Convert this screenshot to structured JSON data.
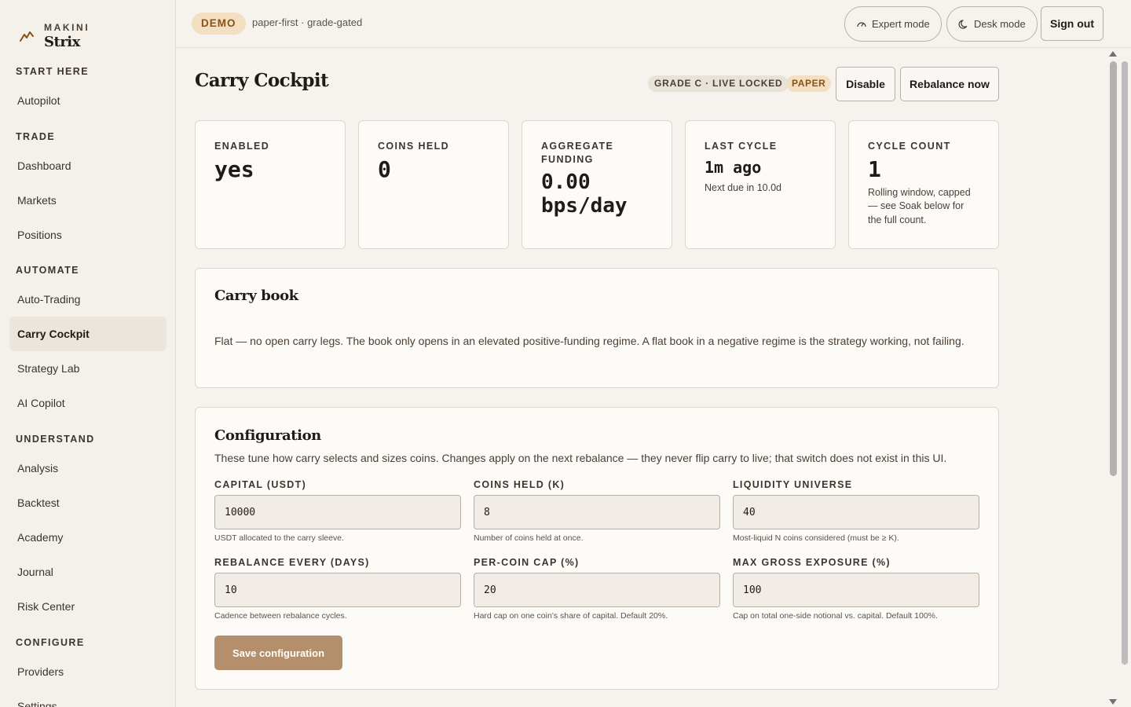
{
  "brand": {
    "kicker": "MAKINI",
    "name": "Strix"
  },
  "nav": {
    "sections": [
      {
        "title": "START HERE",
        "items": [
          "Autopilot"
        ]
      },
      {
        "title": "TRADE",
        "items": [
          "Dashboard",
          "Markets",
          "Positions"
        ]
      },
      {
        "title": "AUTOMATE",
        "items": [
          "Auto-Trading",
          "Carry Cockpit",
          "Strategy Lab",
          "AI Copilot"
        ]
      },
      {
        "title": "UNDERSTAND",
        "items": [
          "Analysis",
          "Backtest",
          "Academy",
          "Journal",
          "Risk Center"
        ]
      },
      {
        "title": "CONFIGURE",
        "items": [
          "Providers",
          "Settings"
        ]
      }
    ],
    "active": "Carry Cockpit"
  },
  "topbar": {
    "demo_badge": "DEMO",
    "subtitle": "paper-first · grade-gated",
    "expert_mode": "Expert mode",
    "desk_mode": "Desk mode",
    "sign_out": "Sign out"
  },
  "page": {
    "title": "Carry Cockpit",
    "grade_badge": "GRADE C · LIVE LOCKED",
    "paper_badge": "PAPER",
    "disable_button": "Disable",
    "rebalance_button": "Rebalance now"
  },
  "stats": [
    {
      "label": "ENABLED",
      "value": "yes",
      "note": ""
    },
    {
      "label": "COINS HELD",
      "value": "0",
      "note": ""
    },
    {
      "label": "AGGREGATE FUNDING",
      "value": "0.00 bps/day",
      "note": ""
    },
    {
      "label": "LAST CYCLE",
      "value": "1m ago",
      "note": "Next due in 10.0d"
    },
    {
      "label": "CYCLE COUNT",
      "value": "1",
      "note": "Rolling window, capped — see Soak below for the full count."
    }
  ],
  "carry_book": {
    "title": "Carry book",
    "text": "Flat — no open carry legs. The book only opens in an elevated positive-funding regime. A flat book in a negative regime is the strategy working, not failing."
  },
  "configuration": {
    "title": "Configuration",
    "description": "These tune how carry selects and sizes coins. Changes apply on the next rebalance — they never flip carry to live; that switch does not exist in this UI.",
    "fields": [
      {
        "label": "CAPITAL (USDT)",
        "value": "10000",
        "help": "USDT allocated to the carry sleeve."
      },
      {
        "label": "COINS HELD (K)",
        "value": "8",
        "help": "Number of coins held at once."
      },
      {
        "label": "LIQUIDITY UNIVERSE",
        "value": "40",
        "help": "Most-liquid N coins considered (must be ≥ K)."
      },
      {
        "label": "REBALANCE EVERY (DAYS)",
        "value": "10",
        "help": "Cadence between rebalance cycles."
      },
      {
        "label": "PER-COIN CAP (%)",
        "value": "20",
        "help": "Hard cap on one coin's share of capital. Default 20%."
      },
      {
        "label": "MAX GROSS EXPOSURE (%)",
        "value": "100",
        "help": "Cap on total one-side notional vs. capital. Default 100%."
      }
    ],
    "save_button": "Save configuration"
  }
}
